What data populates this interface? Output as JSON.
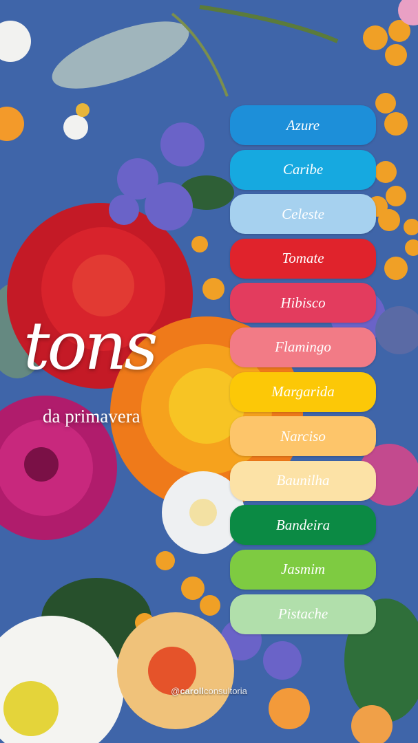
{
  "title": {
    "script": "tons",
    "subtitle": "da primavera"
  },
  "palette": [
    {
      "label": "Azure",
      "color": "#1d8fd9",
      "text": "#ffffff"
    },
    {
      "label": "Caribe",
      "color": "#16a9e0",
      "text": "#ffffff"
    },
    {
      "label": "Celeste",
      "color": "#a6d1ef",
      "text": "#ffffff"
    },
    {
      "label": "Tomate",
      "color": "#e0232c",
      "text": "#ffffff"
    },
    {
      "label": "Hibisco",
      "color": "#e33c5e",
      "text": "#ffffff"
    },
    {
      "label": "Flamingo",
      "color": "#f27b86",
      "text": "#ffffff"
    },
    {
      "label": "Margarida",
      "color": "#fcc807",
      "text": "#ffffff"
    },
    {
      "label": "Narciso",
      "color": "#fdc56a",
      "text": "#ffffff"
    },
    {
      "label": "Baunilha",
      "color": "#fce2a6",
      "text": "#ffffff"
    },
    {
      "label": "Bandeira",
      "color": "#0b8a44",
      "text": "#ffffff"
    },
    {
      "label": "Jasmim",
      "color": "#7ecb41",
      "text": "#ffffff"
    },
    {
      "label": "Pistache",
      "color": "#b1dfab",
      "text": "#ffffff"
    }
  ],
  "credit": {
    "prefix": "@",
    "bold": "caroll",
    "rest": "consultoria"
  }
}
